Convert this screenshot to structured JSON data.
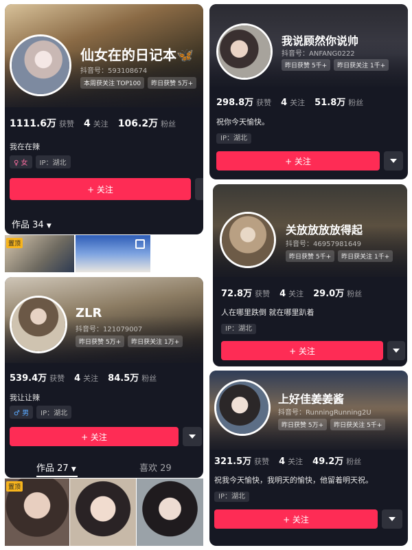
{
  "cards": [
    {
      "name": "仙女在的日记本🦋",
      "id_label": "抖音号：593108674",
      "tags": [
        "本周获关注 TOP100",
        "昨日获赞 5万+"
      ],
      "likes": "1111.6万",
      "likes_label": "获赞",
      "following": "4",
      "following_label": "关注",
      "fans": "106.2万",
      "fans_label": "粉丝",
      "bio": "我在在辣",
      "gender": "♀ 女",
      "ip": "IP：湖北",
      "follow": "+ 关注",
      "works_tab": "作品 34",
      "pinned": "置顶"
    },
    {
      "name": "我说顾然你说帅",
      "id_label": "抖音号：ANFANG0222",
      "tags": [
        "昨日获赞 5千+",
        "昨日获关注 1千+"
      ],
      "likes": "298.8万",
      "likes_label": "获赞",
      "following": "4",
      "following_label": "关注",
      "fans": "51.8万",
      "fans_label": "粉丝",
      "bio": "祝你今天愉快。",
      "ip": "IP：湖北",
      "follow": "+ 关注"
    },
    {
      "name": "关放放放放得起",
      "id_label": "抖音号：46957981649",
      "tags": [
        "昨日获赞 5千+",
        "昨日获关注 1千+"
      ],
      "likes": "72.8万",
      "likes_label": "获赞",
      "following": "4",
      "following_label": "关注",
      "fans": "29.0万",
      "fans_label": "粉丝",
      "bio": "人在哪里跌倒 就在哪里趴着",
      "ip": "IP：湖北",
      "follow": "+ 关注"
    },
    {
      "name": "ZLR",
      "id_label": "抖音号：121079007",
      "tags": [
        "昨日获赞 5万+",
        "昨日获关注 1万+"
      ],
      "likes": "539.4万",
      "likes_label": "获赞",
      "following": "4",
      "following_label": "关注",
      "fans": "84.5万",
      "fans_label": "粉丝",
      "bio": "我让让辣",
      "gender": "♂ 男",
      "ip": "IP：湖北",
      "follow": "+ 关注",
      "works_tab": "作品 27",
      "likes_tab": "喜欢 29",
      "pinned": "置顶"
    },
    {
      "name": "上好佳姜姜酱",
      "id_label": "抖音号：RunningRunning2U",
      "tags": [
        "昨日获赞 5万+",
        "昨日获关注 5千+"
      ],
      "likes": "321.5万",
      "likes_label": "获赞",
      "following": "4",
      "following_label": "关注",
      "fans": "49.2万",
      "fans_label": "粉丝",
      "bio": "祝我今天愉快，我明天的愉快，他留着明天祝。",
      "ip": "IP：湖北",
      "follow": "+ 关注"
    }
  ],
  "colors": {
    "card_bg": "#161823",
    "follow_red": "#fe2c55",
    "pin_yellow": "#f8b51d"
  }
}
